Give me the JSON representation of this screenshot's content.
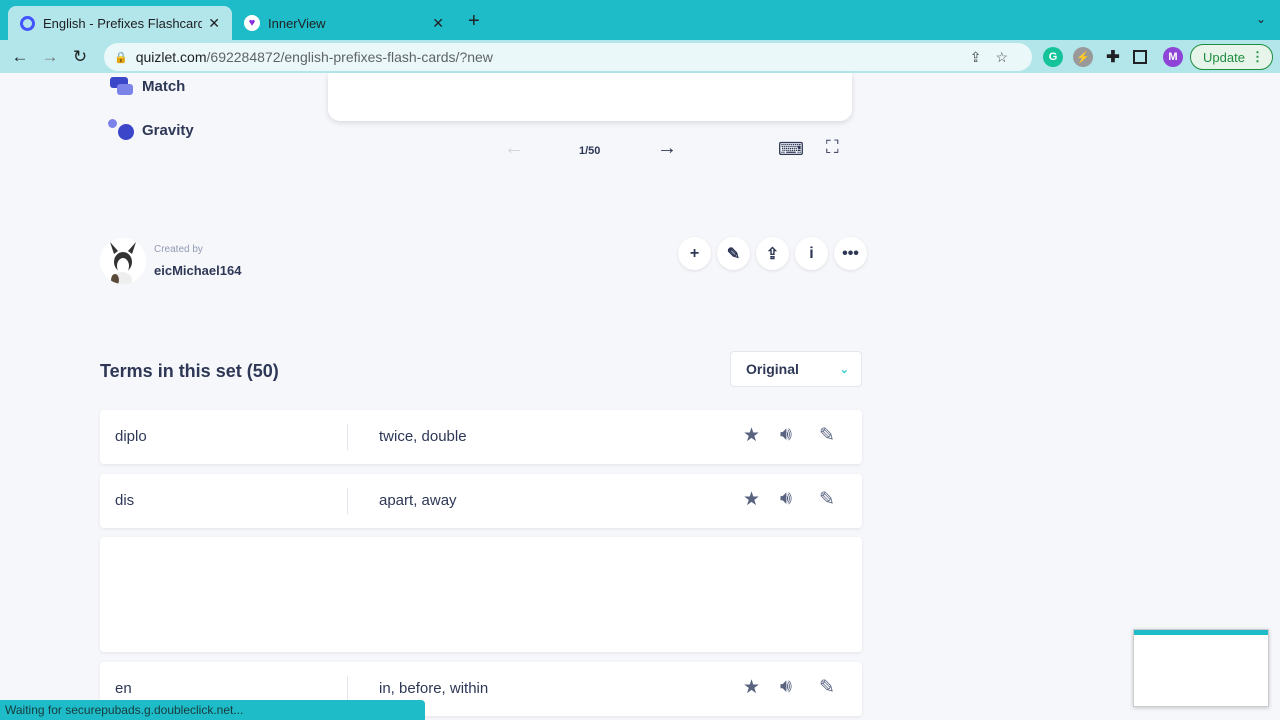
{
  "browser": {
    "tabs": [
      {
        "title": "English - Prefixes Flashcards |",
        "active": true
      },
      {
        "title": "InnerView",
        "active": false
      }
    ],
    "url_domain": "quizlet.com",
    "url_path": "/692284872/english-prefixes-flash-cards/?new",
    "profile_initial": "M",
    "update_label": "Update",
    "status_text": "Waiting for securepubads.g.doubleclick.net..."
  },
  "study_modes": [
    {
      "label": "Match"
    },
    {
      "label": "Gravity"
    }
  ],
  "flashcard": {
    "counter": "1/50"
  },
  "creator": {
    "created_by_label": "Created by",
    "username": "eicMichael164"
  },
  "terms": {
    "heading": "Terms in this set (50)",
    "sort_selected": "Original",
    "rows": [
      {
        "term": "diplo",
        "definition": "twice, double"
      },
      {
        "term": "dis",
        "definition": "apart, away"
      },
      {
        "term": "en",
        "definition": "in, before, within"
      }
    ]
  },
  "colors": {
    "tabbar": "#1dbcc8",
    "accent": "#4255ff",
    "text": "#2e3856"
  }
}
